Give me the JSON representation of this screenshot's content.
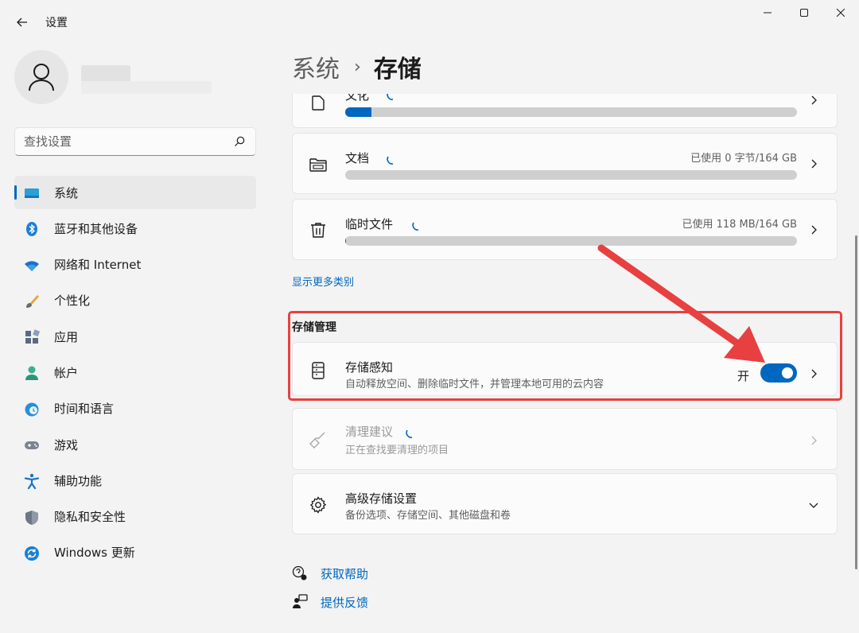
{
  "window": {
    "title": "设置"
  },
  "user": {
    "name": "",
    "email": ""
  },
  "search": {
    "placeholder": "查找设置"
  },
  "nav": {
    "items": [
      {
        "label": "系统",
        "icon": "system-monitor-icon",
        "selected": true
      },
      {
        "label": "蓝牙和其他设备",
        "icon": "bluetooth-icon"
      },
      {
        "label": "网络和 Internet",
        "icon": "wifi-icon"
      },
      {
        "label": "个性化",
        "icon": "brush-icon"
      },
      {
        "label": "应用",
        "icon": "apps-icon"
      },
      {
        "label": "帐户",
        "icon": "account-icon"
      },
      {
        "label": "时间和语言",
        "icon": "time-language-icon"
      },
      {
        "label": "游戏",
        "icon": "gamepad-icon"
      },
      {
        "label": "辅助功能",
        "icon": "accessibility-icon"
      },
      {
        "label": "隐私和安全性",
        "icon": "shield-icon"
      },
      {
        "label": "Windows 更新",
        "icon": "windows-update-icon"
      }
    ]
  },
  "breadcrumb": {
    "parent": "系统",
    "separator": "›",
    "current": "存储"
  },
  "storage": {
    "partial_title": "文化",
    "partial_fill": 0.058,
    "documents": {
      "title": "文档",
      "usage": "已使用 0 字节/164 GB",
      "fill": 0
    },
    "temp": {
      "title": "临时文件",
      "usage": "已使用 118 MB/164 GB",
      "fill": 0.0007
    },
    "show_more": "显示更多类别"
  },
  "management": {
    "section_title": "存储管理",
    "storage_sense": {
      "title": "存储感知",
      "subtitle": "自动释放空间、删除临时文件，并管理本地可用的云内容",
      "toggle_label": "开",
      "toggle_on": true
    },
    "cleanup": {
      "title": "清理建议",
      "subtitle": "正在查找要清理的项目"
    },
    "advanced": {
      "title": "高级存储设置",
      "subtitle": "备份选项、存储空间、其他磁盘和卷"
    }
  },
  "links": {
    "help": "获取帮助",
    "feedback": "提供反馈"
  },
  "colors": {
    "accent": "#0067c0",
    "annotation": "#e84040"
  }
}
